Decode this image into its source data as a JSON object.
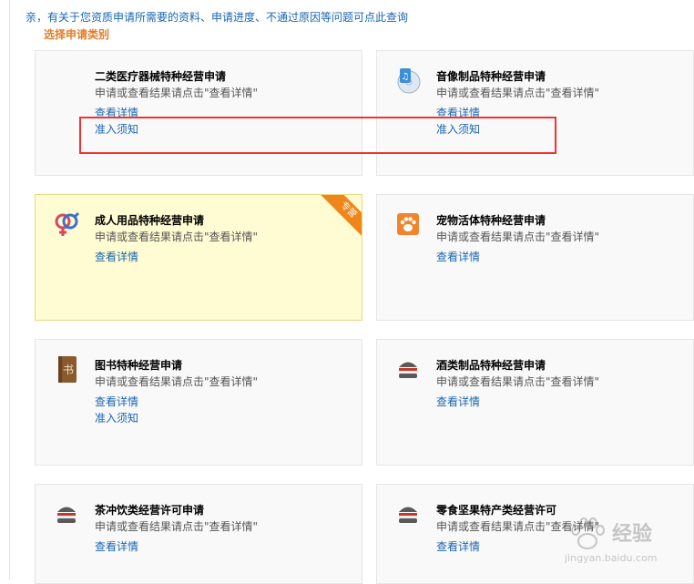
{
  "notice": "亲，有关于您资质申请所需要的资料、申请进度、不通过原因等问题可点此查询",
  "section_title": "选择申请类别",
  "cards": [
    {
      "title": "二类医疗器械特种经营申请",
      "desc": "申请或查看结果请点击\"查看详情\"",
      "link1": "查看详情",
      "link2": "准入须知",
      "icon": "medical-device-icon"
    },
    {
      "title": "音像制品特种经营申请",
      "desc": "申请或查看结果请点击\"查看详情\"",
      "link1": "查看详情",
      "link2": "准入须知",
      "icon": "music-disc-icon"
    },
    {
      "title": "成人用品特种经营申请",
      "desc": "申请或查看结果请点击\"查看详情\"",
      "link1": "查看详情",
      "icon": "gender-symbol-icon",
      "ribbon": "专营"
    },
    {
      "title": "宠物活体特种经营申请",
      "desc": "申请或查看结果请点击\"查看详情\"",
      "link1": "查看详情",
      "icon": "paw-icon"
    },
    {
      "title": "图书特种经营申请",
      "desc": "申请或查看结果请点击\"查看详情\"",
      "link1": "查看详情",
      "link2": "准入须知",
      "icon": "book-icon",
      "icon_text": "书"
    },
    {
      "title": "酒类制品特种经营申请",
      "desc": "申请或查看结果请点击\"查看详情\"",
      "link1": "查看详情",
      "icon": "burger-icon"
    },
    {
      "title": "茶冲饮类经营许可申请",
      "desc": "申请或查看结果请点击\"查看详情\"",
      "link1": "查看详情",
      "icon": "burger-icon"
    },
    {
      "title": "零食坚果特产类经营许可",
      "desc": "申请或查看结果请点击\"查看详情\"",
      "link1": "查看详情",
      "icon": "burger-icon"
    }
  ],
  "watermark": {
    "main": "经验",
    "sub": "jingyan.baidu.com",
    "brand": "Baidu"
  },
  "colors": {
    "accent_link": "#1a66b3",
    "section_title": "#e07e2a",
    "highlight_bg": "#fffbd2",
    "ribbon": "#f08519",
    "annotation_box": "#e33"
  }
}
